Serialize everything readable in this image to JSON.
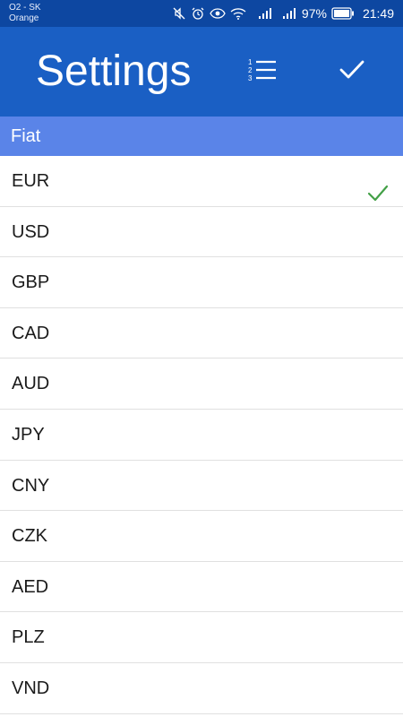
{
  "status_bar": {
    "carrier_line1": "O2 - SK",
    "carrier_line2": "Orange",
    "battery_percent": "97%",
    "time": "21:49",
    "icons": [
      "mute-icon",
      "alarm-icon",
      "eye-icon",
      "wifi-icon",
      "signal-icon",
      "signal-icon",
      "battery-icon"
    ]
  },
  "app_bar": {
    "title": "Settings",
    "sort_icon": "numbered-list-icon",
    "done_icon": "check-icon",
    "background": "#1a5fc4"
  },
  "section": {
    "label": "Fiat",
    "background": "#5a84e8"
  },
  "currencies": [
    {
      "code": "EUR",
      "selected": true
    },
    {
      "code": "USD",
      "selected": false
    },
    {
      "code": "GBP",
      "selected": false
    },
    {
      "code": "CAD",
      "selected": false
    },
    {
      "code": "AUD",
      "selected": false
    },
    {
      "code": "JPY",
      "selected": false
    },
    {
      "code": "CNY",
      "selected": false
    },
    {
      "code": "CZK",
      "selected": false
    },
    {
      "code": "AED",
      "selected": false
    },
    {
      "code": "PLZ",
      "selected": false
    },
    {
      "code": "VND",
      "selected": false
    }
  ],
  "colors": {
    "selected_check": "#43a047",
    "status_bar": "#0d47a1"
  }
}
